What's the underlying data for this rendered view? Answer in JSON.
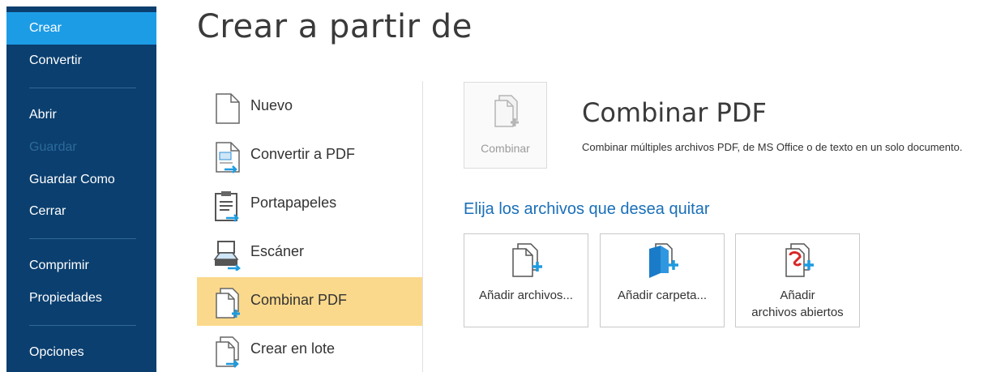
{
  "sidebar": {
    "items": [
      {
        "label": "Crear"
      },
      {
        "label": "Convertir"
      },
      {
        "label": "Abrir"
      },
      {
        "label": "Guardar"
      },
      {
        "label": "Guardar Como"
      },
      {
        "label": "Cerrar"
      },
      {
        "label": "Comprimir"
      },
      {
        "label": "Propiedades"
      },
      {
        "label": "Opciones"
      }
    ],
    "active": "Crear",
    "disabled": "Guardar"
  },
  "page_title": "Crear a partir de",
  "options": [
    {
      "label": "Nuevo",
      "icon": "new-document-icon"
    },
    {
      "label": "Convertir a PDF",
      "icon": "convert-to-pdf-icon"
    },
    {
      "label": "Portapapeles",
      "icon": "clipboard-icon"
    },
    {
      "label": "Escáner",
      "icon": "scanner-icon"
    },
    {
      "label": "Combinar PDF",
      "icon": "combine-pdf-icon"
    },
    {
      "label": "Crear en lote",
      "icon": "batch-create-icon"
    }
  ],
  "selected_option": "Combinar PDF",
  "panel": {
    "combine_tile_label": "Combinar",
    "title": "Combinar PDF",
    "description": "Combinar múltiples archivos PDF, de MS Office o de texto en un solo documento.",
    "choose_heading": "Elija los archivos que desea quitar",
    "actions": [
      {
        "label": "Añadir archivos...",
        "icon": "add-files-icon"
      },
      {
        "label": "Añadir carpeta...",
        "icon": "add-folder-icon"
      },
      {
        "label_line1": "Añadir",
        "label_line2": "archivos abiertos",
        "icon": "add-open-files-icon"
      }
    ]
  },
  "colors": {
    "sidebar_bg": "#0b3f6f",
    "sidebar_active": "#1d9ce6",
    "selected_option_bg": "#fbd98c",
    "accent_blue": "#1a6fb8",
    "icon_plus": "#1e9be0"
  }
}
